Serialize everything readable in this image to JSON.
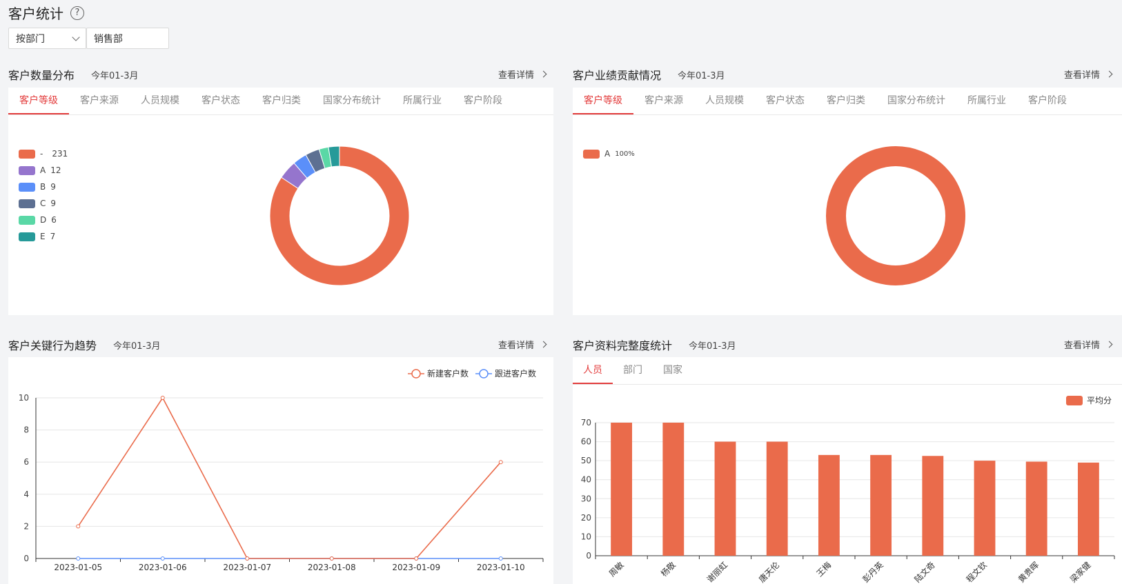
{
  "page": {
    "title": "客户统计",
    "help_icon": "?"
  },
  "filters": {
    "dimension": "按部门",
    "department": "销售部"
  },
  "detail_label": "查看详情",
  "sections": {
    "distribution": {
      "title": "客户数量分布",
      "period": "今年01-3月"
    },
    "contribution": {
      "title": "客户业绩贡献情况",
      "period": "今年01-3月"
    },
    "trend": {
      "title": "客户关键行为趋势",
      "period": "今年01-3月"
    },
    "completeness": {
      "title": "客户资料完整度统计",
      "period": "今年01-3月"
    }
  },
  "tabs": [
    "客户等级",
    "客户来源",
    "人员规模",
    "客户状态",
    "客户归类",
    "国家分布统计",
    "所属行业",
    "客户阶段"
  ],
  "completeness_tabs": [
    "人员",
    "部门",
    "国家"
  ],
  "chart_data": [
    {
      "type": "pie",
      "slices": [
        {
          "label": "-",
          "value": 231,
          "color": "#ea6b4b"
        },
        {
          "label": "A",
          "value": 12,
          "color": "#9575cd"
        },
        {
          "label": "B",
          "value": 9,
          "color": "#5b8ff9"
        },
        {
          "label": "C",
          "value": 9,
          "color": "#5d7092"
        },
        {
          "label": "D",
          "value": 6,
          "color": "#5ad8a6"
        },
        {
          "label": "E",
          "value": 7,
          "color": "#269a99"
        }
      ],
      "legend": "left"
    },
    {
      "type": "pie",
      "slices": [
        {
          "label": "A",
          "value": 100,
          "display": "100%",
          "color": "#ea6b4b"
        }
      ],
      "legend": "left"
    },
    {
      "type": "line",
      "x": [
        "2023-01-05",
        "2023-01-06",
        "2023-01-07",
        "2023-01-08",
        "2023-01-09",
        "2023-01-10"
      ],
      "series": [
        {
          "name": "新建客户数",
          "values": [
            2,
            10,
            0,
            0,
            0,
            6
          ],
          "color": "#ea6b4b"
        },
        {
          "name": "跟进客户数",
          "values": [
            0,
            0,
            0,
            0,
            0,
            0
          ],
          "color": "#5b8ff9"
        }
      ],
      "ylim": [
        0,
        10
      ],
      "yticks": [
        0,
        2,
        4,
        6,
        8,
        10
      ],
      "legend": "top-right",
      "grid": true
    },
    {
      "type": "bar",
      "categories": [
        "周敏",
        "杨敬",
        "谢丽虹",
        "唐天伦",
        "王梅",
        "彭丹英",
        "陆文奇",
        "程文钦",
        "黄贵晖",
        "梁家健"
      ],
      "series": [
        {
          "name": "平均分",
          "values": [
            70,
            70,
            60,
            60,
            53,
            53,
            52.5,
            50,
            49.5,
            49
          ],
          "color": "#ea6b4b"
        }
      ],
      "ylim": [
        0,
        70
      ],
      "yticks": [
        0,
        10,
        20,
        30,
        40,
        50,
        60,
        70
      ],
      "legend": "top-right",
      "grid": true
    }
  ]
}
